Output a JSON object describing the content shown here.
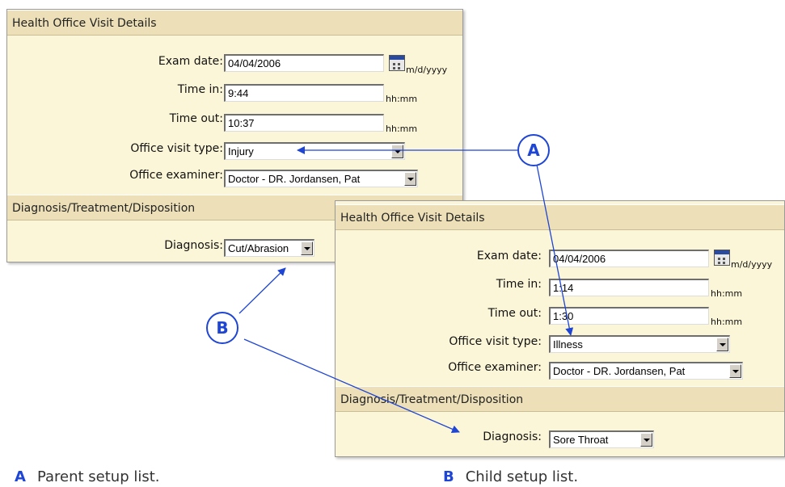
{
  "parent_panel": {
    "title": "Health Office Visit Details",
    "exam_date_label": "Exam date:",
    "exam_date_value": "04/04/2006",
    "date_format": "m/d/yyyy",
    "time_in_label": "Time in:",
    "time_in_value": "9:44",
    "time_out_label": "Time out:",
    "time_out_value": "10:37",
    "time_format": "hh:mm",
    "visit_type_label": "Office visit type:",
    "visit_type_value": "Injury",
    "examiner_label": "Office examiner:",
    "examiner_value": "Doctor - DR. Jordansen, Pat",
    "section2_title": "Diagnosis/Treatment/Disposition",
    "diagnosis_label": "Diagnosis:",
    "diagnosis_value": "Cut/Abrasion"
  },
  "child_panel": {
    "title": "Health Office Visit Details",
    "exam_date_label": "Exam date:",
    "exam_date_value": "04/04/2006",
    "date_format": "m/d/yyyy",
    "time_in_label": "Time in:",
    "time_in_value": "1:14",
    "time_out_label": "Time out:",
    "time_out_value": "1:30",
    "time_format": "hh:mm",
    "visit_type_label": "Office visit type:",
    "visit_type_value": "Illness",
    "examiner_label": "Office examiner:",
    "examiner_value": "Doctor - DR. Jordansen, Pat",
    "section2_title": "Diagnosis/Treatment/Disposition",
    "diagnosis_label": "Diagnosis:",
    "diagnosis_value": "Sore Throat"
  },
  "callouts": {
    "a": "A",
    "b": "B"
  },
  "legend": {
    "a_key": "A",
    "a_text": "Parent setup list.",
    "b_key": "B",
    "b_text": "Child setup list."
  },
  "colors": {
    "panel_bg": "#fcf6d8",
    "band_bg": "#ede0b8",
    "accent": "#1e45d4"
  }
}
